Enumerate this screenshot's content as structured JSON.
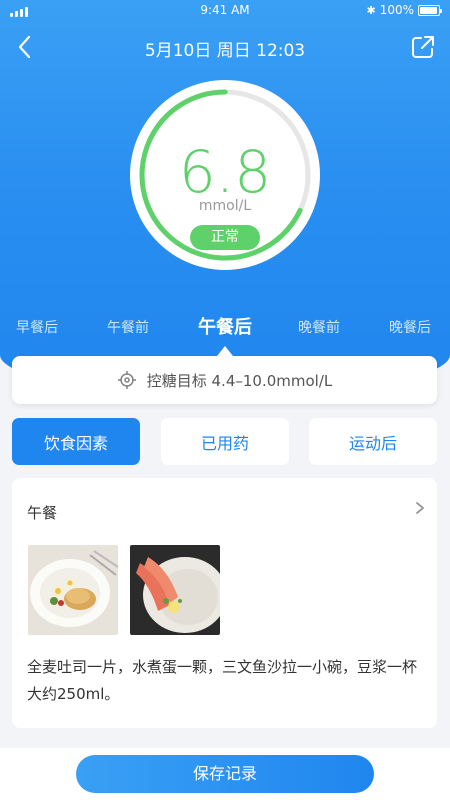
{
  "status": {
    "time": "9:41 AM",
    "battery": "100%"
  },
  "header": {
    "title": "5月10日  周日  12:03"
  },
  "reading": {
    "value": "6.8",
    "unit": "mmol/L",
    "status": "正常",
    "progress": 0.68
  },
  "tabs": [
    {
      "label": "早餐后",
      "active": false
    },
    {
      "label": "午餐前",
      "active": false
    },
    {
      "label": "午餐后",
      "active": true
    },
    {
      "label": "晚餐前",
      "active": false
    },
    {
      "label": "晚餐后",
      "active": false
    }
  ],
  "target": {
    "text": "控糖目标 4.4–10.0mmol/L"
  },
  "factors": [
    {
      "label": "饮食因素",
      "selected": true
    },
    {
      "label": "已用药",
      "selected": false
    },
    {
      "label": "运动后",
      "selected": false
    }
  ],
  "meal": {
    "title": "午餐",
    "description": "全麦吐司一片，水煮蛋一颗，三文鱼沙拉一小碗，豆浆一杯大约250ml。"
  },
  "footer": {
    "save_label": "保存记录"
  },
  "colors": {
    "accent": "#1f86ef",
    "normal": "#5fd16a"
  }
}
